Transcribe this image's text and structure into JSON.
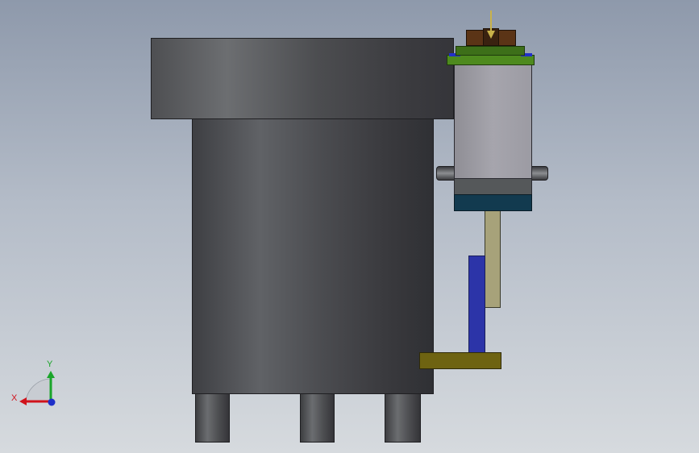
{
  "viewport": {
    "background": "gradient",
    "triad": {
      "x_label": "X",
      "y_label": "Y",
      "x_color": "#d0121b",
      "y_color": "#1aa52a",
      "z_color": "#1d2fc9"
    }
  },
  "model": {
    "colors": {
      "cylinder": "#4a4b4f",
      "rod": "#a7a27a",
      "blue_bar": "#2c34a8",
      "foot_plate": "#6e6311",
      "valve_body": "#a6a5ad",
      "valve_base": "#123a4f",
      "green_plate": "#4e8a1e",
      "brown_block": "#5b3416"
    }
  }
}
